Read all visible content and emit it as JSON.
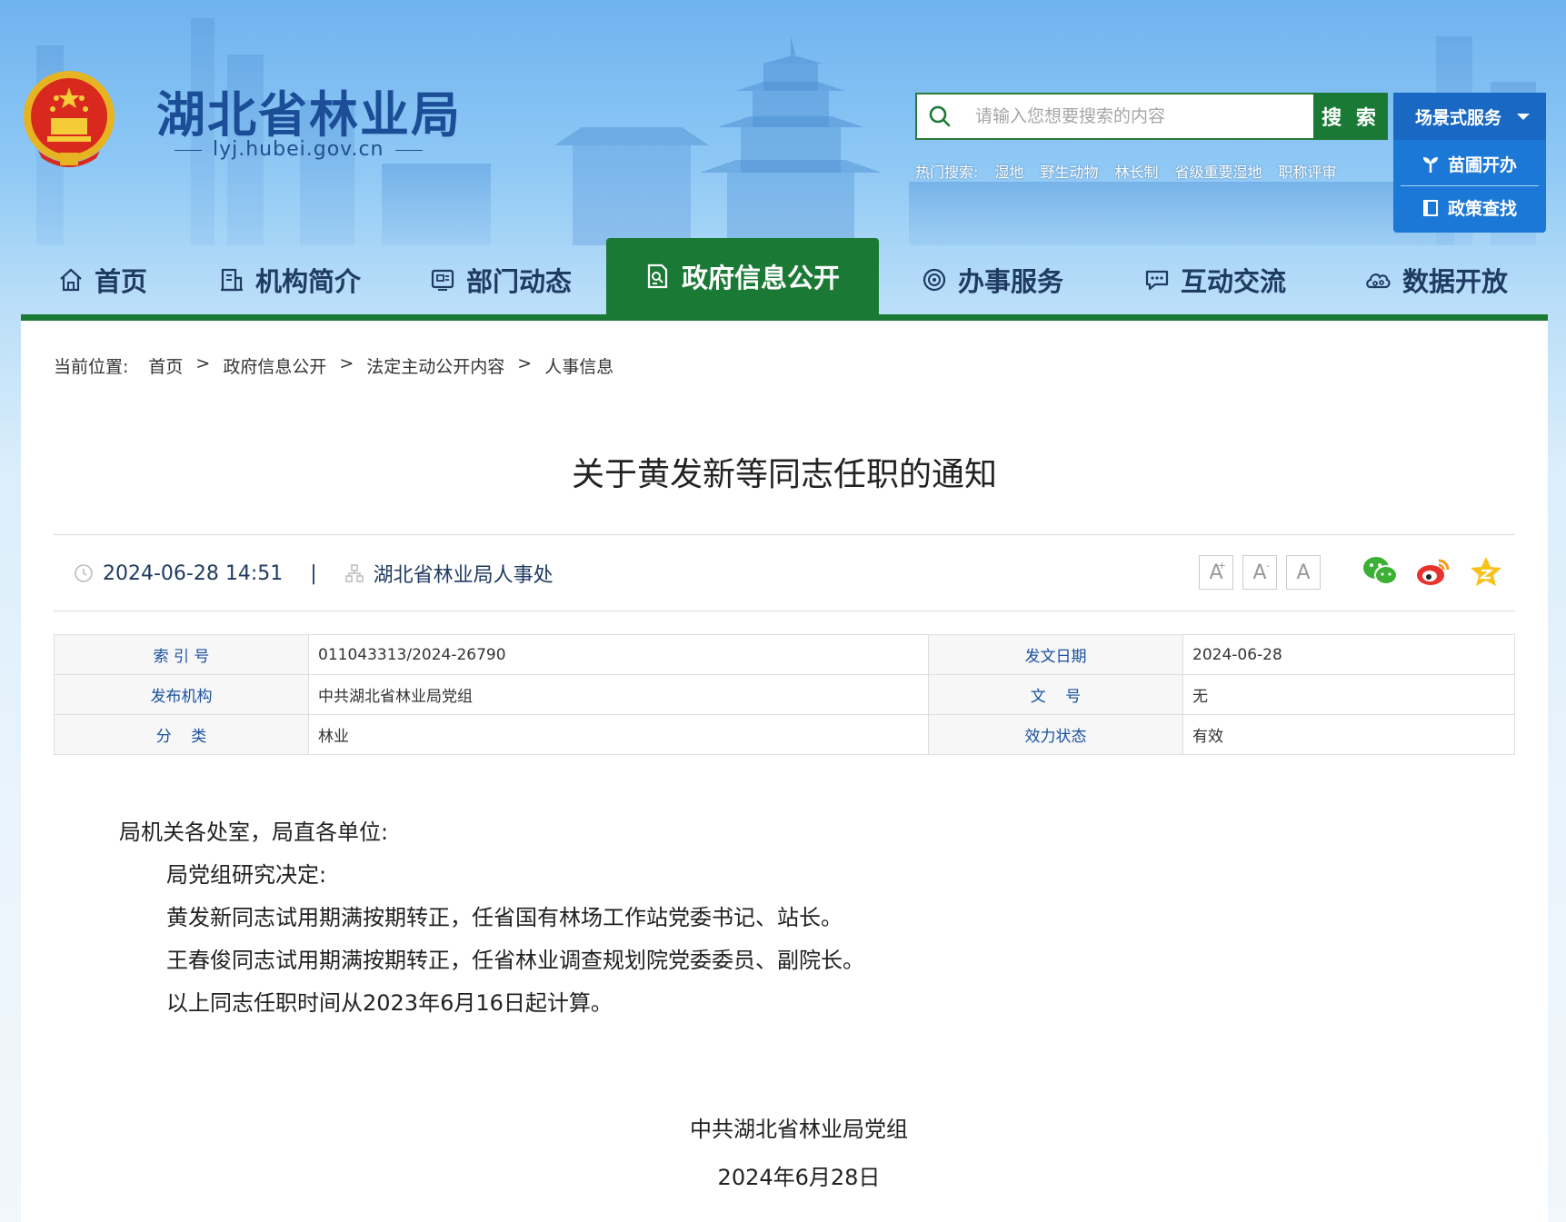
{
  "header": {
    "site_title": "湖北省林业局",
    "site_url": "lyj.hubei.gov.cn",
    "search_placeholder": "请输入您想要搜索的内容",
    "search_button": "搜 索",
    "hot_search_label": "热门搜索:",
    "hot_search_items": [
      "湿地",
      "野生动物",
      "林长制",
      "省级重要湿地",
      "职称评审"
    ],
    "scene_service": {
      "label": "场景式服务",
      "items": [
        "苗圃开办",
        "政策查找"
      ]
    }
  },
  "nav": {
    "items": [
      "首页",
      "机构简介",
      "部门动态",
      "政府信息公开",
      "办事服务",
      "互动交流",
      "数据开放"
    ],
    "active_index": 3
  },
  "breadcrumb": {
    "label": "当前位置:",
    "items": [
      "首页",
      "政府信息公开",
      "法定主动公开内容",
      "人事信息"
    ],
    "separator": ">"
  },
  "article": {
    "title": "关于黄发新等同志任职的通知",
    "datetime": "2024-06-28 14:51",
    "source": "湖北省林业局人事处",
    "font_tools": [
      "A",
      "A",
      "A"
    ]
  },
  "info_table": {
    "rows": [
      {
        "k1": "索 引 号",
        "v1": "011043313/2024-26790",
        "k2": "发文日期",
        "v2": "2024-06-28"
      },
      {
        "k1": "发布机构",
        "v1": "中共湖北省林业局党组",
        "k2": "文    号",
        "v2": "无"
      },
      {
        "k1": "分    类",
        "v1": "林业",
        "k2": "效力状态",
        "v2": "有效"
      }
    ]
  },
  "body": {
    "salutation": "局机关各处室，局直各单位:",
    "paragraphs": [
      "局党组研究决定:",
      "黄发新同志试用期满按期转正，任省国有林场工作站党委书记、站长。",
      "王春俊同志试用期满按期转正，任省林业调查规划院党委委员、副院长。",
      "以上同志任职时间从2023年6月16日起计算。"
    ],
    "signature": "中共湖北省林业局党组",
    "sign_date": "2024年6月28日"
  },
  "colors": {
    "primary_green": "#1a7a35",
    "nav_text": "#1f3b62",
    "scene_blue": "#1868c4"
  }
}
